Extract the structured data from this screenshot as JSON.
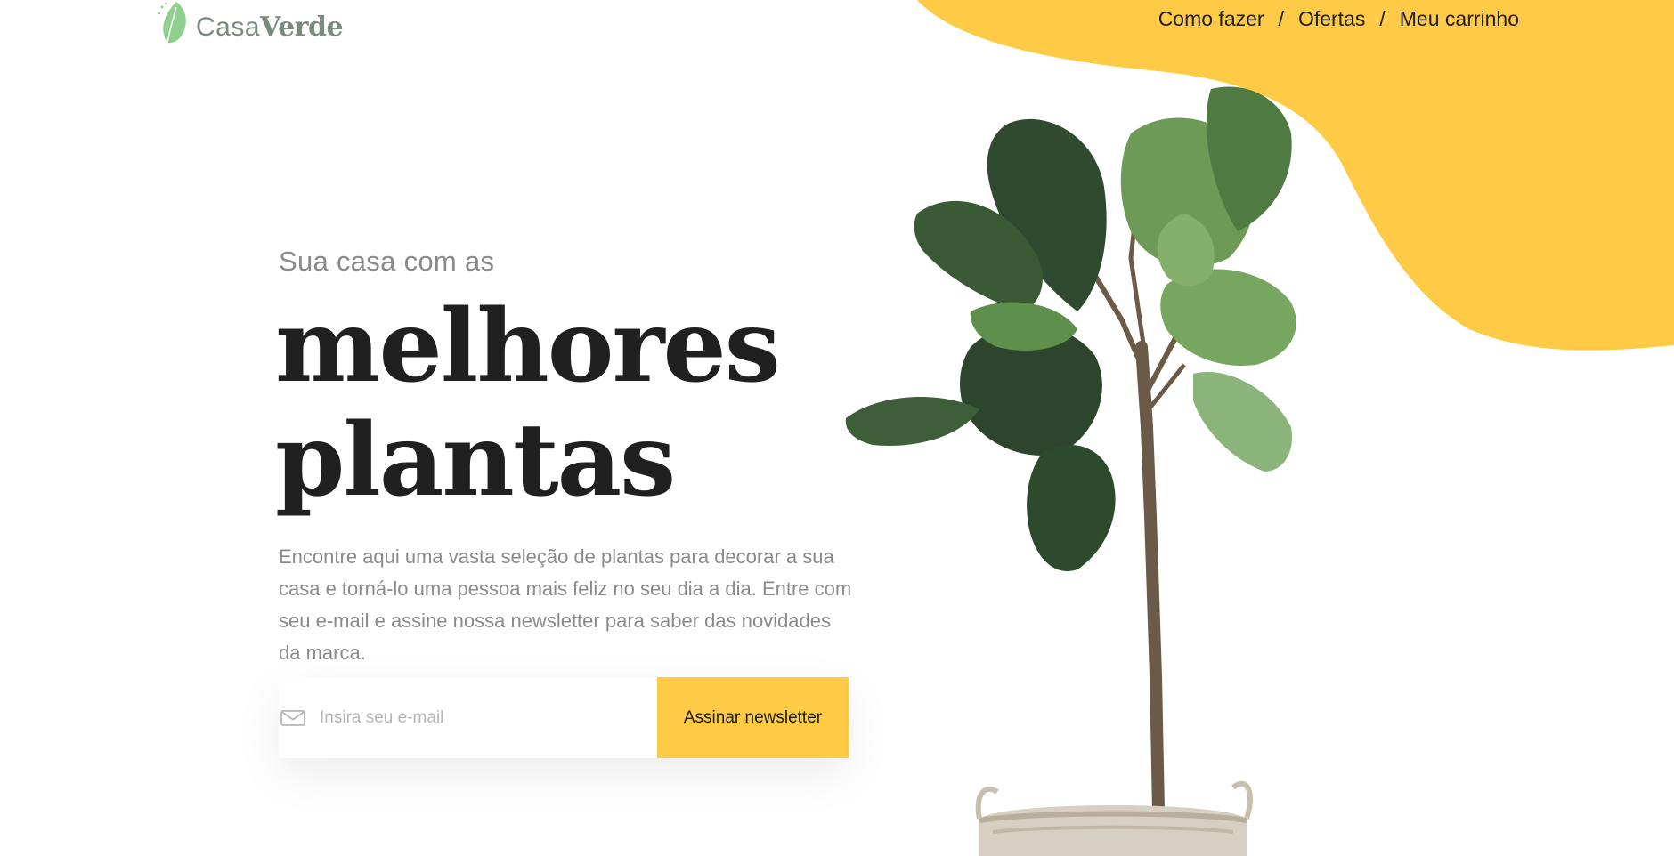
{
  "brand": {
    "name_part1": "Casa",
    "name_part2": "Verde",
    "logo_icon": "leaf-icon"
  },
  "nav": {
    "items": [
      {
        "label": "Como fazer"
      },
      {
        "label": "Ofertas"
      },
      {
        "label": "Meu carrinho"
      }
    ],
    "separator": "/"
  },
  "hero": {
    "subtitle": "Sua casa com as",
    "title_line1": "melhores",
    "title_line2": "plantas",
    "description": "Encontre aqui uma vasta seleção de plantas para decorar a sua casa e torná-lo uma pessoa mais feliz no seu dia a dia. Entre com seu e-mail e assine nossa newsletter para saber das novidades da marca."
  },
  "newsletter": {
    "placeholder": "Insira seu e-mail",
    "value": "",
    "button_label": "Assinar newsletter",
    "icon": "mail-icon"
  },
  "colors": {
    "accent": "#ffcb47",
    "text_dark": "#202020",
    "text_muted": "#8a8a8a",
    "brand_green": "#7a8a7c",
    "leaf_green": "#8fcf8f"
  },
  "image": {
    "plant": "plant-in-basket-image"
  }
}
